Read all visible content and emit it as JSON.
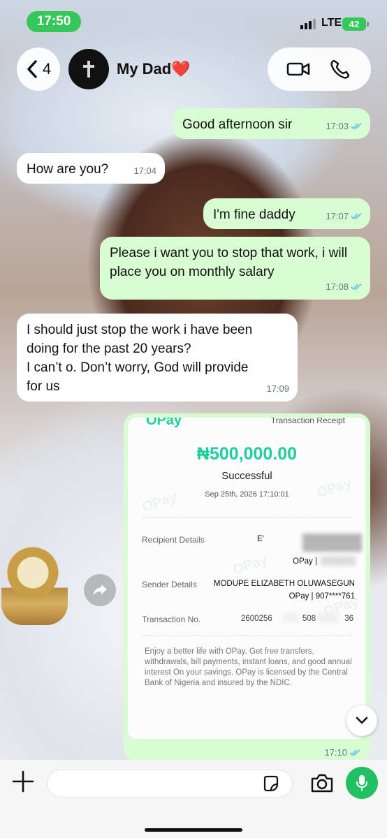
{
  "status_bar": {
    "time": "17:50",
    "network": "LTE",
    "battery": "42"
  },
  "header": {
    "back_count": "4",
    "contact_name": "My Dad",
    "contact_emoji": "❤️"
  },
  "messages": [
    {
      "direction": "out",
      "text": "Good afternoon sir",
      "time": "17:03",
      "read": true
    },
    {
      "direction": "in",
      "text": "How are you?",
      "time": "17:04"
    },
    {
      "direction": "out",
      "text": "I'm fine daddy",
      "time": "17:07",
      "read": true
    },
    {
      "direction": "out",
      "text": "Please i want you to stop that work, i will place you on monthly salary",
      "time": "17:08",
      "read": true
    },
    {
      "direction": "in",
      "lines": [
        "I should just stop the work i have been",
        "doing for the past 20 years?",
        "I can’t o. Don’t worry, God will provide",
        "for us"
      ],
      "time": "17:09"
    }
  ],
  "receipt": {
    "brand": "OPay",
    "header_right": "Transaction Receipt",
    "amount": "₦500,000.00",
    "status": "Successful",
    "date": "Sep 25th, 2026 17:10:01",
    "recipient_label": "Recipient Details",
    "recipient_name": "E'",
    "recipient_bank": "OPay |",
    "sender_label": "Sender Details",
    "sender_name": "MODUPE ELIZABETH OLUWASEGUN",
    "sender_bank": "OPay | 907****761",
    "txn_label": "Transaction No.",
    "txn_value_a": "2600256",
    "txn_value_b": "508",
    "txn_value_c": "36",
    "footer": "Enjoy a better life with OPay. Get free transfers, withdrawals, bill payments, instant loans, and good annual interest On your savings. OPay is licensed by the Central Bank of Nigeria and insured by the NDIC.",
    "watermark": "OPay",
    "time": "17:10",
    "read": true
  },
  "colors": {
    "accent_green": "#34c759",
    "opay_green": "#1dcf9f",
    "out_bubble": "#d9fdd3",
    "in_bubble": "#ffffff",
    "read_tick": "#53bdeb",
    "mic_green": "#21c063"
  },
  "icons": {
    "back": "chevron-left-icon",
    "video": "video-camera-icon",
    "call": "phone-icon",
    "forward": "forward-arrow-icon",
    "scroll": "chevron-down-icon",
    "add": "plus-icon",
    "sticker": "sticker-icon",
    "camera": "camera-icon",
    "mic": "microphone-icon"
  }
}
